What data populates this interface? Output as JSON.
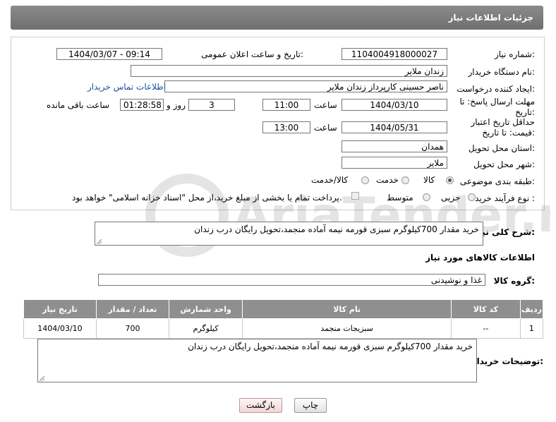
{
  "header": {
    "title": "جزئیات اطلاعات نیاز"
  },
  "form": {
    "need_number_label": "شماره نیاز:",
    "need_number": "1104004918000027",
    "announce_label": "تاریخ و ساعت اعلان عمومی:",
    "announce_value": "1404/03/07 - 09:14",
    "buyer_org_label": "نام دستگاه خریدار:",
    "buyer_org": "زندان ملایر",
    "creator_label": "ایجاد کننده درخواست:",
    "creator": "ناصر  حسینی کارپرداز زندان ملایر",
    "contact_link": "اطلاعات تماس خریدار",
    "deadline_label": "مهلت ارسال پاسخ: تا تاریخ:",
    "deadline_date": "1404/03/10",
    "time_label": "ساعت",
    "deadline_time": "11:00",
    "days_value": "3",
    "days_label": "روز و",
    "remaining_time": "01:28:58",
    "remaining_label": "ساعت باقی مانده",
    "validity_label": "حداقل تاریخ اعتبار قیمت: تا تاریخ:",
    "validity_date": "1404/05/31",
    "validity_time": "13:00",
    "province_label": "استان محل تحویل:",
    "province": "همدان",
    "city_label": "شهر محل تحویل:",
    "city": "ملایر",
    "category_label": "طبقه بندی موضوعی:",
    "category_options": [
      "کالا",
      "خدمت",
      "کالا/خدمت"
    ],
    "process_label": "نوع فرآیند خرید :",
    "process_options": [
      "جزیی",
      "متوسط"
    ],
    "payment_note": "پرداخت تمام یا بخشی از مبلغ خرید،از محل \"اسناد خزانه اسلامی\" خواهد بود."
  },
  "description": {
    "label": "شرح کلی نیاز:",
    "text": "خرید مقدار 700کیلوگرم سبزی قورمه نیمه آماده منجمد،تحویل رایگان درب زندان"
  },
  "goods": {
    "section_title": "اطلاعات کالاهای مورد نیاز",
    "group_label": "گروه کالا:",
    "group_value": "غذا و نوشیدنی",
    "columns": [
      "ردیف",
      "کد کالا",
      "نام کالا",
      "واحد شمارش",
      "تعداد / مقدار",
      "تاریخ نیاز"
    ],
    "rows": [
      [
        "1",
        "--",
        "سبزیجات منجمد",
        "کیلوگرم",
        "700",
        "1404/03/10"
      ]
    ]
  },
  "buyer_notes": {
    "label": "توضیحات خریدار:",
    "text": "خرید مقدار 700کیلوگرم سبزی قورمه نیمه آماده منجمد،تحویل رایگان درب زندان"
  },
  "buttons": {
    "print": "چاپ",
    "back": "بازگشت"
  },
  "watermark": {
    "text": "AriaTender.neT"
  }
}
